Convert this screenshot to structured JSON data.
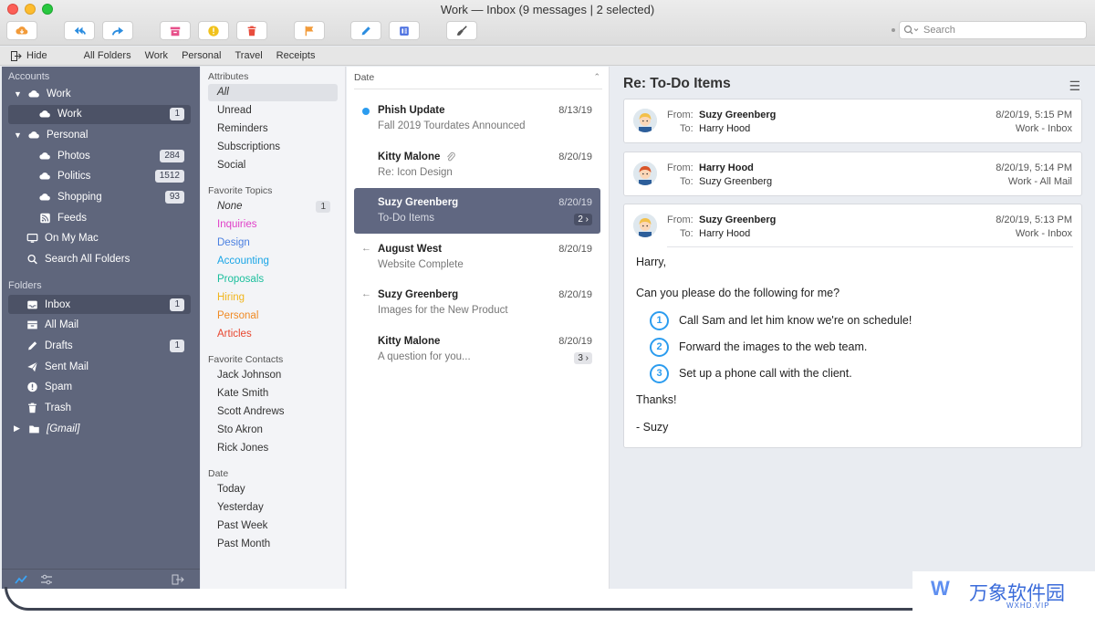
{
  "window": {
    "title": "Work — Inbox (9 messages | 2 selected)"
  },
  "toolbar": {
    "buttons": [
      {
        "name": "get-mail",
        "icon": "cloud-download-icon",
        "color": "#f29a38"
      },
      {
        "name": "reply-all",
        "icon": "reply-all-icon",
        "color": "#2b8de0"
      },
      {
        "name": "forward",
        "icon": "forward-icon",
        "color": "#2b8de0"
      },
      {
        "name": "archive",
        "icon": "archive-icon",
        "color": "#e7508a"
      },
      {
        "name": "junk",
        "icon": "warning-icon",
        "color": "#f1c21c"
      },
      {
        "name": "delete",
        "icon": "trash-icon",
        "color": "#e84c3c"
      },
      {
        "name": "flag",
        "icon": "flag-icon",
        "color": "#f29a38"
      },
      {
        "name": "compose",
        "icon": "pencil-icon",
        "color": "#2b8de0"
      },
      {
        "name": "contacts",
        "icon": "address-book-icon",
        "color": "#4a6fe0"
      },
      {
        "name": "cleanup",
        "icon": "broom-icon",
        "color": "#555555"
      }
    ],
    "search_placeholder": "Search"
  },
  "favbar": {
    "hide_label": "Hide",
    "items": [
      "All Folders",
      "Work",
      "Personal",
      "Travel",
      "Receipts"
    ]
  },
  "sidebar": {
    "accounts_label": "Accounts",
    "folders_label": "Folders",
    "accounts": [
      {
        "label": "Work",
        "level": 0,
        "expanded": true,
        "icon": "cloud-icon"
      },
      {
        "label": "Work",
        "level": 1,
        "badge": "1",
        "selected": true,
        "icon": "cloud-icon"
      },
      {
        "label": "Personal",
        "level": 0,
        "expanded": true,
        "icon": "cloud-icon"
      },
      {
        "label": "Photos",
        "level": 1,
        "badge": "284",
        "icon": "cloud-icon"
      },
      {
        "label": "Politics",
        "level": 1,
        "badge": "1512",
        "icon": "cloud-icon"
      },
      {
        "label": "Shopping",
        "level": 1,
        "badge": "93",
        "icon": "cloud-icon"
      },
      {
        "label": "Feeds",
        "level": 1,
        "icon": "rss-icon"
      },
      {
        "label": "On My Mac",
        "level": 0,
        "icon": "monitor-icon"
      },
      {
        "label": "Search All Folders",
        "level": 0,
        "icon": "search-icon"
      }
    ],
    "folders": [
      {
        "label": "Inbox",
        "badge": "1",
        "selected": true,
        "icon": "inbox-icon"
      },
      {
        "label": "All Mail",
        "icon": "all-mail-icon"
      },
      {
        "label": "Drafts",
        "badge": "1",
        "icon": "pencil-icon"
      },
      {
        "label": "Sent Mail",
        "icon": "send-icon"
      },
      {
        "label": "Spam",
        "icon": "warning-icon"
      },
      {
        "label": "Trash",
        "icon": "trash-icon"
      },
      {
        "label": "[Gmail]",
        "icon": "folder-icon",
        "collapsed": true
      }
    ]
  },
  "filters": {
    "attributes_label": "Attributes",
    "attributes": [
      "All",
      "Unread",
      "Reminders",
      "Subscriptions",
      "Social"
    ],
    "topics_label": "Favorite Topics",
    "topics": [
      {
        "label": "None",
        "badge": "1",
        "color": "#333333"
      },
      {
        "label": "Inquiries",
        "color": "#e040c8"
      },
      {
        "label": "Design",
        "color": "#4a7fe0"
      },
      {
        "label": "Accounting",
        "color": "#1aa5e6"
      },
      {
        "label": "Proposals",
        "color": "#1bbf9c"
      },
      {
        "label": "Hiring",
        "color": "#f1b51c"
      },
      {
        "label": "Personal",
        "color": "#f08a24"
      },
      {
        "label": "Articles",
        "color": "#e8462f"
      }
    ],
    "contacts_label": "Favorite Contacts",
    "contacts": [
      "Jack Johnson",
      "Kate Smith",
      "Scott Andrews",
      "Sto Akron",
      "Rick Jones"
    ],
    "date_label": "Date",
    "dates": [
      "Today",
      "Yesterday",
      "Past Week",
      "Past Month"
    ]
  },
  "messages": {
    "sort_label": "Date",
    "items": [
      {
        "from": "Phish Update",
        "subject": "Fall 2019 Tourdates Announced",
        "date": "8/13/19",
        "unread": true
      },
      {
        "from": "Kitty Malone",
        "subject": "Re: Icon Design",
        "date": "8/20/19",
        "attachment": true
      },
      {
        "from": "Suzy Greenberg",
        "subject": "To-Do Items",
        "date": "8/20/19",
        "thread": "2",
        "selected": true
      },
      {
        "from": "August West",
        "subject": "Website Complete",
        "date": "8/20/19",
        "replied": true
      },
      {
        "from": "Suzy Greenberg",
        "subject": "Images for the New Product",
        "date": "8/20/19",
        "replied": true
      },
      {
        "from": "Kitty Malone",
        "subject": "A question for you...",
        "date": "8/20/19",
        "thread": "3"
      }
    ]
  },
  "reader": {
    "title": "Re: To-Do Items",
    "from_label": "From:",
    "to_label": "To:",
    "headers": [
      {
        "from": "Suzy Greenberg",
        "to": "Harry Hood",
        "date": "8/20/19, 5:15 PM",
        "folder": "Work - Inbox",
        "avatar": "blonde"
      },
      {
        "from": "Harry Hood",
        "to": "Suzy Greenberg",
        "date": "8/20/19, 5:14 PM",
        "folder": "Work - All Mail",
        "avatar": "redhead"
      },
      {
        "from": "Suzy Greenberg",
        "to": "Harry Hood",
        "date": "8/20/19, 5:13 PM",
        "folder": "Work - Inbox",
        "avatar": "blonde"
      }
    ],
    "body": {
      "greeting": "Harry,",
      "intro": "Can you please do the following for me?",
      "steps": [
        {
          "num": "1",
          "text": "Call Sam and let him know we're on schedule!"
        },
        {
          "num": "2",
          "text": "Forward the images to the web team."
        },
        {
          "num": "3",
          "text": "Set up a phone call with the client."
        }
      ],
      "thanks": "Thanks!",
      "signoff": "- Suzy"
    }
  },
  "watermark": {
    "text": "万象软件园",
    "sub": "WXHD.VIP"
  }
}
